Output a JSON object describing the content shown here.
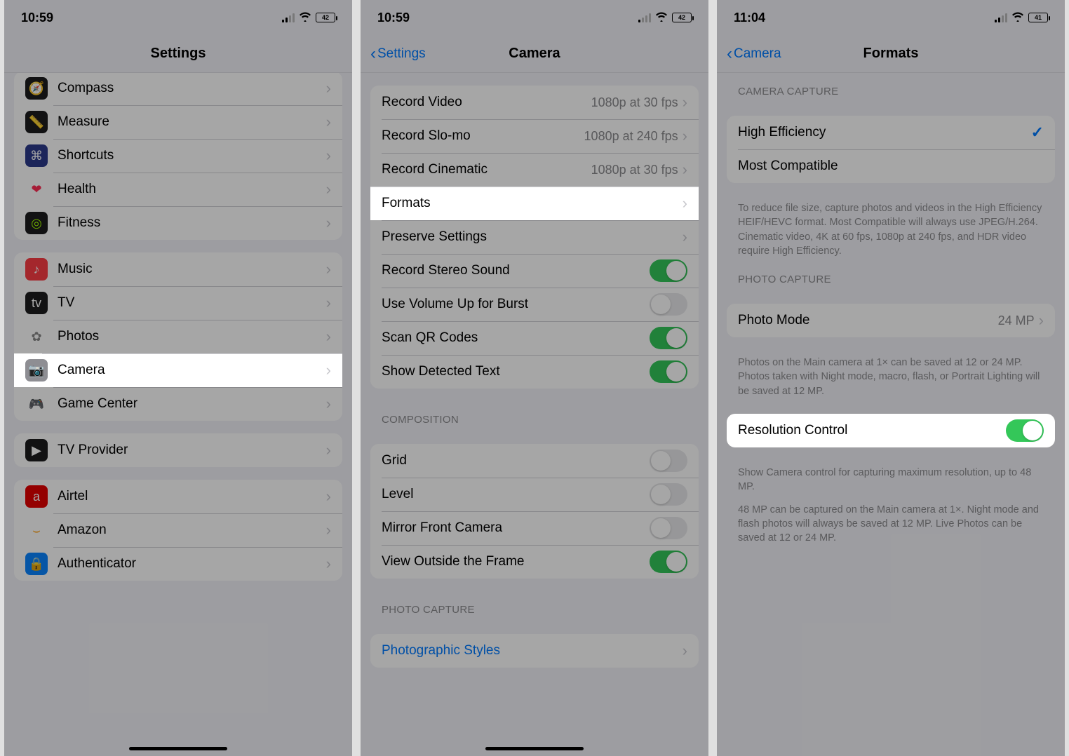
{
  "phones": {
    "settings": {
      "time": "10:59",
      "battery": "42",
      "title": "Settings",
      "groups": [
        {
          "items": [
            {
              "label": "Compass",
              "icon": "🧭",
              "bg": "#1c1c1e"
            },
            {
              "label": "Measure",
              "icon": "📏",
              "bg": "#1c1c1e"
            },
            {
              "label": "Shortcuts",
              "icon": "⌘",
              "bg": "#2c3a8a"
            },
            {
              "label": "Health",
              "icon": "❤",
              "bg": "#ffffff",
              "fg": "#ff2d55"
            },
            {
              "label": "Fitness",
              "icon": "◎",
              "bg": "#1c1c1e",
              "fg": "#a4ff00"
            }
          ]
        },
        {
          "items": [
            {
              "label": "Music",
              "icon": "♪",
              "bg": "#fc3c44"
            },
            {
              "label": "TV",
              "icon": "tv",
              "bg": "#1c1c1e"
            },
            {
              "label": "Photos",
              "icon": "✿",
              "bg": "#ffffff",
              "fg": "#888"
            },
            {
              "label": "Camera",
              "icon": "📷",
              "bg": "#8e8e93",
              "highlight": true
            },
            {
              "label": "Game Center",
              "icon": "🎮",
              "bg": "#ffffff"
            }
          ]
        },
        {
          "items": [
            {
              "label": "TV Provider",
              "icon": "▶",
              "bg": "#1c1c1e"
            }
          ]
        },
        {
          "items": [
            {
              "label": "Airtel",
              "icon": "a",
              "bg": "#e40000"
            },
            {
              "label": "Amazon",
              "icon": "⌣",
              "bg": "#ffffff",
              "fg": "#ff9900"
            },
            {
              "label": "Authenticator",
              "icon": "🔒",
              "bg": "#0a84ff"
            }
          ]
        }
      ]
    },
    "camera": {
      "time": "10:59",
      "battery": "42",
      "back": "Settings",
      "title": "Camera",
      "groups": [
        {
          "items": [
            {
              "label": "Record Video",
              "value": "1080p at 30 fps",
              "chev": true
            },
            {
              "label": "Record Slo-mo",
              "value": "1080p at 240 fps",
              "chev": true
            },
            {
              "label": "Record Cinematic",
              "value": "1080p at 30 fps",
              "chev": true
            },
            {
              "label": "Formats",
              "chev": true,
              "highlight": true
            },
            {
              "label": "Preserve Settings",
              "chev": true
            },
            {
              "label": "Record Stereo Sound",
              "toggle": true
            },
            {
              "label": "Use Volume Up for Burst",
              "toggle": false
            },
            {
              "label": "Scan QR Codes",
              "toggle": true
            },
            {
              "label": "Show Detected Text",
              "toggle": true
            }
          ]
        },
        {
          "header": "COMPOSITION",
          "items": [
            {
              "label": "Grid",
              "toggle": false
            },
            {
              "label": "Level",
              "toggle": false
            },
            {
              "label": "Mirror Front Camera",
              "toggle": false
            },
            {
              "label": "View Outside the Frame",
              "toggle": true
            }
          ]
        },
        {
          "header": "PHOTO CAPTURE",
          "items": [
            {
              "label": "Photographic Styles",
              "link": true,
              "chev": true
            }
          ]
        }
      ]
    },
    "formats": {
      "time": "11:04",
      "battery": "41",
      "back": "Camera",
      "title": "Formats",
      "groups": [
        {
          "header": "CAMERA CAPTURE",
          "items": [
            {
              "label": "High Efficiency",
              "check": true
            },
            {
              "label": "Most Compatible"
            }
          ],
          "footer": "To reduce file size, capture photos and videos in the High Efficiency HEIF/HEVC format. Most Compatible will always use JPEG/H.264. Cinematic video, 4K at 60 fps, 1080p at 240 fps, and HDR video require High Efficiency."
        },
        {
          "header": "PHOTO CAPTURE",
          "items": [
            {
              "label": "Photo Mode",
              "value": "24 MP",
              "chev": true
            }
          ],
          "footer": "Photos on the Main camera at 1× can be saved at 12 or 24 MP. Photos taken with Night mode, macro, flash, or Portrait Lighting will be saved at 12 MP."
        },
        {
          "items": [
            {
              "label": "Resolution Control",
              "toggle": true,
              "highlight": true
            }
          ],
          "footer": "Show Camera control for capturing maximum resolution, up to 48 MP."
        },
        {
          "footer_only": true,
          "footer": "48 MP can be captured on the Main camera at 1×. Night mode and flash photos will always be saved at 12 MP. Live Photos can be saved at 12 or 24 MP."
        }
      ]
    }
  }
}
